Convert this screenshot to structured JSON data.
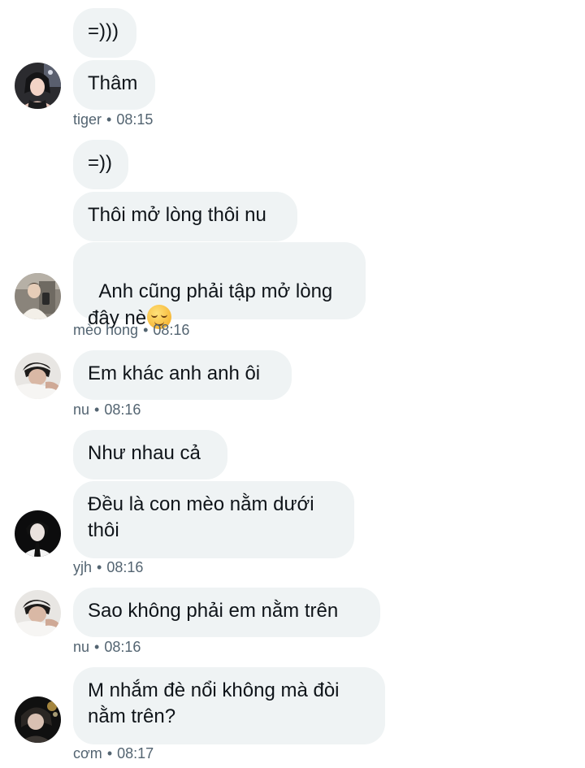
{
  "conversation": [
    {
      "sender": "tiger",
      "time": "08:15",
      "messages": [
        "=)))",
        "Thâm"
      ]
    },
    {
      "sender": "mèo hong",
      "time": "08:16",
      "messages": [
        "=))",
        "Thôi mở lòng thôi nu",
        "Anh cũng phải tập mở lòng\nđây nè"
      ],
      "emoji": "relieved-face-emoji"
    },
    {
      "sender": "nu",
      "time": "08:16",
      "messages": [
        "Em khác anh anh ôi"
      ]
    },
    {
      "sender": "yjh",
      "time": "08:16",
      "messages": [
        "Như nhau cả",
        "Đều là con mèo nằm dưới\nthôi"
      ]
    },
    {
      "sender": "nu",
      "time": "08:16",
      "messages": [
        "Sao không phải em nằm trên"
      ]
    },
    {
      "sender": "cơm",
      "time": "08:17",
      "messages": [
        "M nhắm đè nổi không mà đòi\nnằm trên?"
      ]
    }
  ],
  "separator": "•",
  "colors": {
    "bubble": "#eff3f4",
    "text": "#0f1419",
    "meta": "#536471"
  }
}
